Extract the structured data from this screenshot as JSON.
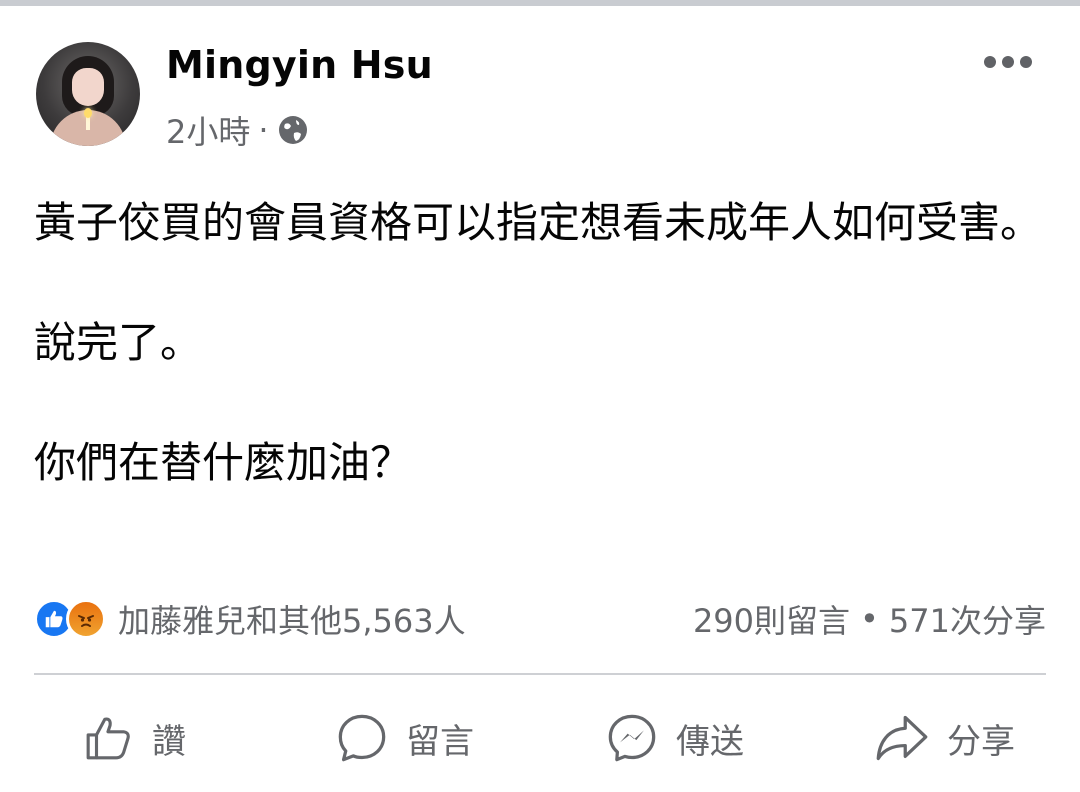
{
  "post": {
    "author": "Mingyin Hsu",
    "time": "2小時",
    "separator": "·",
    "privacy_icon": "globe-icon",
    "paragraphs": [
      "黃子佼買的會員資格可以指定想看未成年人如何受害。",
      "說完了。",
      "你們在替什麼加油？"
    ]
  },
  "engagement": {
    "reaction_icons": [
      "like-icon",
      "angry-icon"
    ],
    "reactions_text": "加藤雅兒和其他5,563人",
    "comments": "290則留言",
    "separator": "•",
    "shares": "571次分享"
  },
  "actions": [
    {
      "label": "讚",
      "icon": "thumbs-up-icon"
    },
    {
      "label": "留言",
      "icon": "comment-icon"
    },
    {
      "label": "傳送",
      "icon": "messenger-icon"
    },
    {
      "label": "分享",
      "icon": "share-icon"
    }
  ],
  "colors": {
    "text": "#050505",
    "secondary": "#65676b",
    "like_blue": "#1877f2",
    "angry_orange": "#e9710f",
    "divider": "#ced0d4"
  }
}
